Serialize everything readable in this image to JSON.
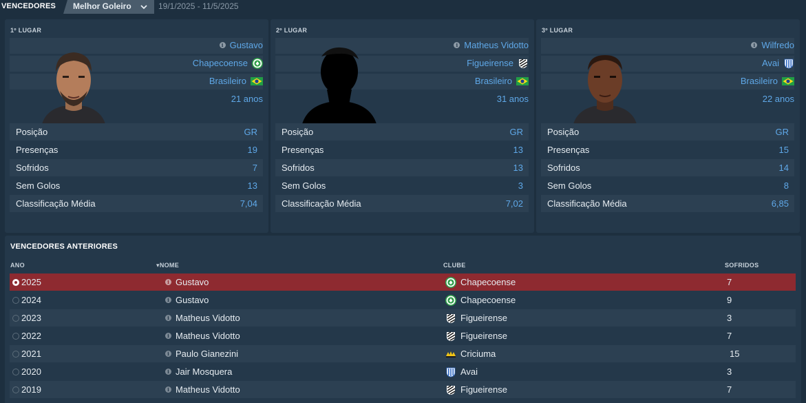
{
  "header": {
    "section_label": "VENCEDORES",
    "award_select": "Melhor Goleiro",
    "date_range": "19/1/2025 - 11/5/2025"
  },
  "cards": [
    {
      "place": "1º LUGAR",
      "name": "Gustavo",
      "club": "Chapecoense",
      "club_crest": "chapecoense-crest",
      "nationality": "Brasileiro",
      "flag": "brazil-flag",
      "age": "21 anos",
      "stats": [
        {
          "label": "Posição",
          "value": "GR"
        },
        {
          "label": "Presenças",
          "value": "19"
        },
        {
          "label": "Sofridos",
          "value": "7"
        },
        {
          "label": "Sem Golos",
          "value": "13"
        },
        {
          "label": "Classificação Média",
          "value": "7,04"
        }
      ]
    },
    {
      "place": "2º LUGAR",
      "name": "Matheus Vidotto",
      "club": "Figueirense",
      "club_crest": "figueirense-crest",
      "nationality": "Brasileiro",
      "flag": "brazil-flag",
      "age": "31 anos",
      "stats": [
        {
          "label": "Posição",
          "value": "GR"
        },
        {
          "label": "Presenças",
          "value": "13"
        },
        {
          "label": "Sofridos",
          "value": "13"
        },
        {
          "label": "Sem Golos",
          "value": "3"
        },
        {
          "label": "Classificação Média",
          "value": "7,02"
        }
      ]
    },
    {
      "place": "3º LUGAR",
      "name": "Wilfredo",
      "club": "Avai",
      "club_crest": "avai-crest",
      "nationality": "Brasileiro",
      "flag": "brazil-flag",
      "age": "22 anos",
      "stats": [
        {
          "label": "Posição",
          "value": "GR"
        },
        {
          "label": "Presenças",
          "value": "15"
        },
        {
          "label": "Sofridos",
          "value": "14"
        },
        {
          "label": "Sem Golos",
          "value": "8"
        },
        {
          "label": "Classificação Média",
          "value": "6,85"
        }
      ]
    }
  ],
  "previous": {
    "title": "VENCEDORES ANTERIORES",
    "columns": {
      "year": "ANO",
      "name": "NOME",
      "club": "CLUBE",
      "conceded": "SOFRIDOS"
    },
    "rows": [
      {
        "year": "2025",
        "name": "Gustavo",
        "club": "Chapecoense",
        "conceded": "7",
        "selected": true
      },
      {
        "year": "2024",
        "name": "Gustavo",
        "club": "Chapecoense",
        "conceded": "9"
      },
      {
        "year": "2023",
        "name": "Matheus Vidotto",
        "club": "Figueirense",
        "conceded": "3"
      },
      {
        "year": "2022",
        "name": "Matheus Vidotto",
        "club": "Figueirense",
        "conceded": "7"
      },
      {
        "year": "2021",
        "name": "Paulo Gianezini",
        "club": "Criciuma",
        "conceded": "15"
      },
      {
        "year": "2020",
        "name": "Jair Mosquera",
        "club": "Avai",
        "conceded": "3"
      },
      {
        "year": "2019",
        "name": "Matheus Vidotto",
        "club": "Figueirense",
        "conceded": "7"
      }
    ]
  },
  "colors": {
    "background": "#1d2f3f",
    "panel": "#24384a",
    "row_alt": "#2c4052",
    "link": "#5fa8e8",
    "selected_row": "#8e2a30"
  }
}
